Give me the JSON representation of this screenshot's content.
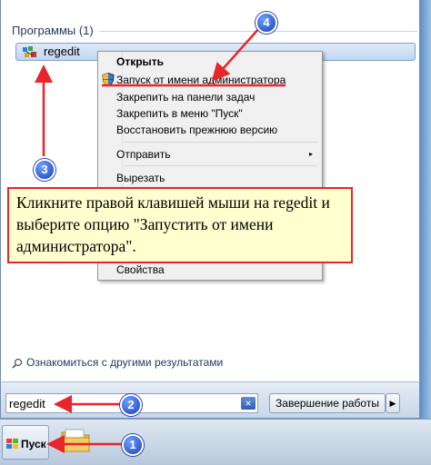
{
  "start_menu": {
    "section_title": "Программы (1)",
    "program_item": {
      "label": "regedit",
      "icon": "regedit-icon"
    },
    "search_more_label": "Ознакомиться с другими результатами",
    "search_input_value": "regedit",
    "clear_icon": "×",
    "shutdown_label": "Завершение работы",
    "shutdown_arrow": "▶"
  },
  "context_menu": {
    "items": [
      {
        "label": "Открыть",
        "bold": true
      },
      {
        "label": "Запуск от имени администратора",
        "icon": "uac-shield-icon"
      },
      {
        "label": "Закрепить на панели задач"
      },
      {
        "label": "Закрепить в меню \"Пуск\""
      },
      {
        "label": "Восстановить прежнюю версию"
      },
      {
        "label": "Отправить",
        "submenu_arrow": "▸"
      },
      {
        "label": "Вырезать"
      },
      {
        "label": "Свойства"
      }
    ]
  },
  "callout": {
    "text": "Кликните правой клавишей мыши на regedit и выберите опцию \"Запустить от имени администратора\"."
  },
  "markers": [
    "1",
    "2",
    "3",
    "4"
  ],
  "taskbar": {
    "start_label": "Пуск",
    "start_icon": "windows-flag-icon",
    "pinned_icon": "folder-icon"
  },
  "colors": {
    "annotation_red": "#e8252a",
    "marker_blue": "#1b3fb7",
    "callout_bg": "#ffffcf"
  }
}
